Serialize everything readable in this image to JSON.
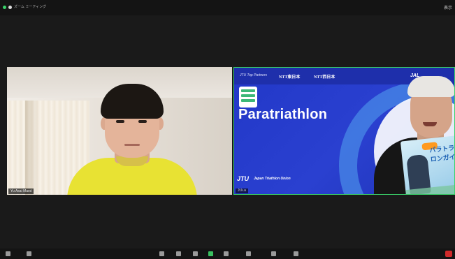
{
  "window": {
    "title": "ズーム ミーティング",
    "view_label": "表示"
  },
  "participants": [
    {
      "name": "Yu Asai Maxd"
    },
    {
      "name": "Jt.k.a"
    }
  ],
  "slide": {
    "sponsor_lead": "JTU Top Partners",
    "sponsors": [
      "NTT東日本",
      "NTT西日本",
      "JAL"
    ],
    "title": "Paratriathlon",
    "footer": "Japan Triathlon Union",
    "footer_mark": "JTU"
  },
  "book": {
    "title": "パラトライアスロンガイド"
  },
  "toolbar": {
    "items": [
      "mute",
      "video",
      "security",
      "participants",
      "chat",
      "share",
      "record",
      "reactions",
      "apps",
      "more"
    ],
    "end_label": "終了"
  },
  "colors": {
    "accent_active_speaker": "#3ad26a",
    "slide_blue": "#2238c8",
    "shirt_yellow": "#e8e233",
    "end_red": "#d02a2a"
  }
}
